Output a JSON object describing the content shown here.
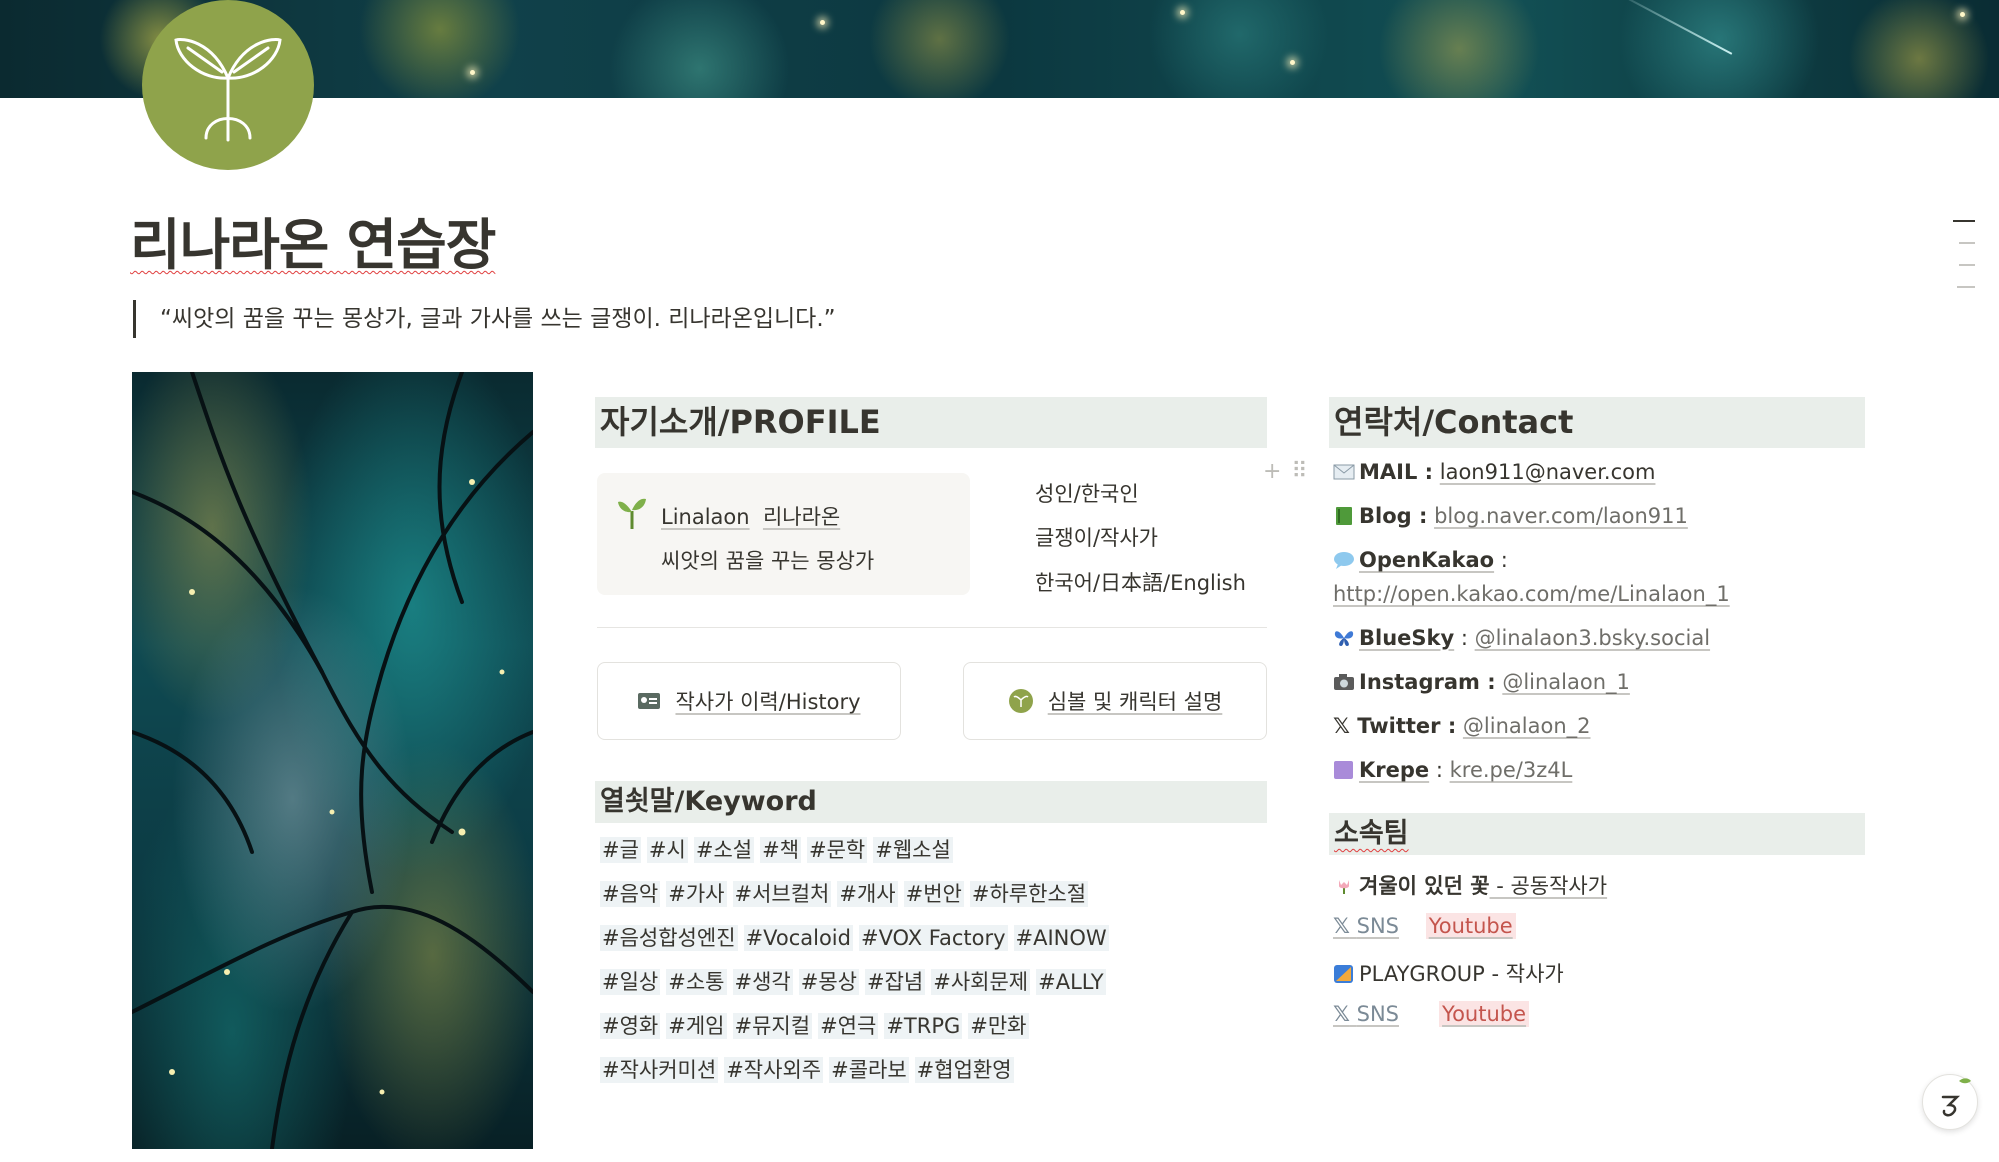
{
  "page": {
    "title": "리나라온 연습장",
    "quote": "“씨앗의 꿈을 꾸는 몽상가, 글과 가사를 쓰는 글쟁이. 리나라온입니다.”"
  },
  "profile": {
    "heading": "자기소개/PROFILE",
    "callout_name_en": "Linalaon",
    "callout_name_ko": "리나라온",
    "callout_sub": "씨앗의 꿈을 꾸는 몽상가",
    "facts": [
      "성인/한국인",
      "글쟁이/작사가",
      "한국어/日本語/English"
    ],
    "links": [
      {
        "label": "작사가 이력/History",
        "icon": "id-card-icon"
      },
      {
        "label": "심볼 및 캐릭터 설명",
        "icon": "green-circle-icon"
      }
    ]
  },
  "keywords": {
    "heading": "열쇳말/Keyword",
    "lines": [
      [
        "#글",
        "#시",
        "#소설",
        "#책",
        "#문학",
        "#웹소설"
      ],
      [
        "#음악",
        "#가사",
        "#서브컬처",
        "#개사",
        "#번안",
        "#하루한소절"
      ],
      [
        "#음성합성엔진",
        "#Vocaloid",
        "#VOX Factory",
        "#AINOW"
      ],
      [
        "#일상",
        "#소통",
        "#생각",
        "#몽상",
        "#잡념",
        "#사회문제",
        "#ALLY"
      ],
      [
        "#영화",
        "#게임",
        "#뮤지컬",
        "#연극",
        "#TRPG",
        "#만화"
      ],
      [
        "#작사커미션",
        "#작사외주",
        "#콜라보",
        "#협업환영"
      ]
    ]
  },
  "contact": {
    "heading": "연락처/Contact",
    "mail_label": "MAIL :",
    "mail_value": "laon911@naver.com",
    "blog_label": "Blog :",
    "blog_value": "blog.naver.com/laon911",
    "openkakao_label": "OpenKakao",
    "openkakao_colon": " :",
    "openkakao_value": "http://open.kakao.com/me/Linalaon_1",
    "bluesky_label": "BlueSky",
    "bluesky_colon": " :",
    "bluesky_value": "@linalaon3.bsky.social",
    "instagram_label": "Instagram :",
    "instagram_value": "@linalaon_1",
    "twitter_label": "𝕏 Twitter :",
    "twitter_value": "@linalaon_2",
    "krepe_label": "Krepe",
    "krepe_colon": " :",
    "krepe_value": "kre.pe/3z4L"
  },
  "team": {
    "heading": "소속팀",
    "team1_name": "겨울이 있던 꽃",
    "team1_role": " - 공동작사가",
    "team1_sns": "SNS",
    "team1_youtube": "Youtube",
    "team2_name": "PLAYGROUP",
    "team2_role": " - 작사가",
    "team2_sns": "SNS",
    "team2_youtube": "Youtube"
  },
  "colors": {
    "icon_green": "#8fa34b",
    "section_bg": "#e9eeea",
    "tag_bg": "#eef3f5",
    "youtube_tag_bg": "#fbe4e4"
  }
}
